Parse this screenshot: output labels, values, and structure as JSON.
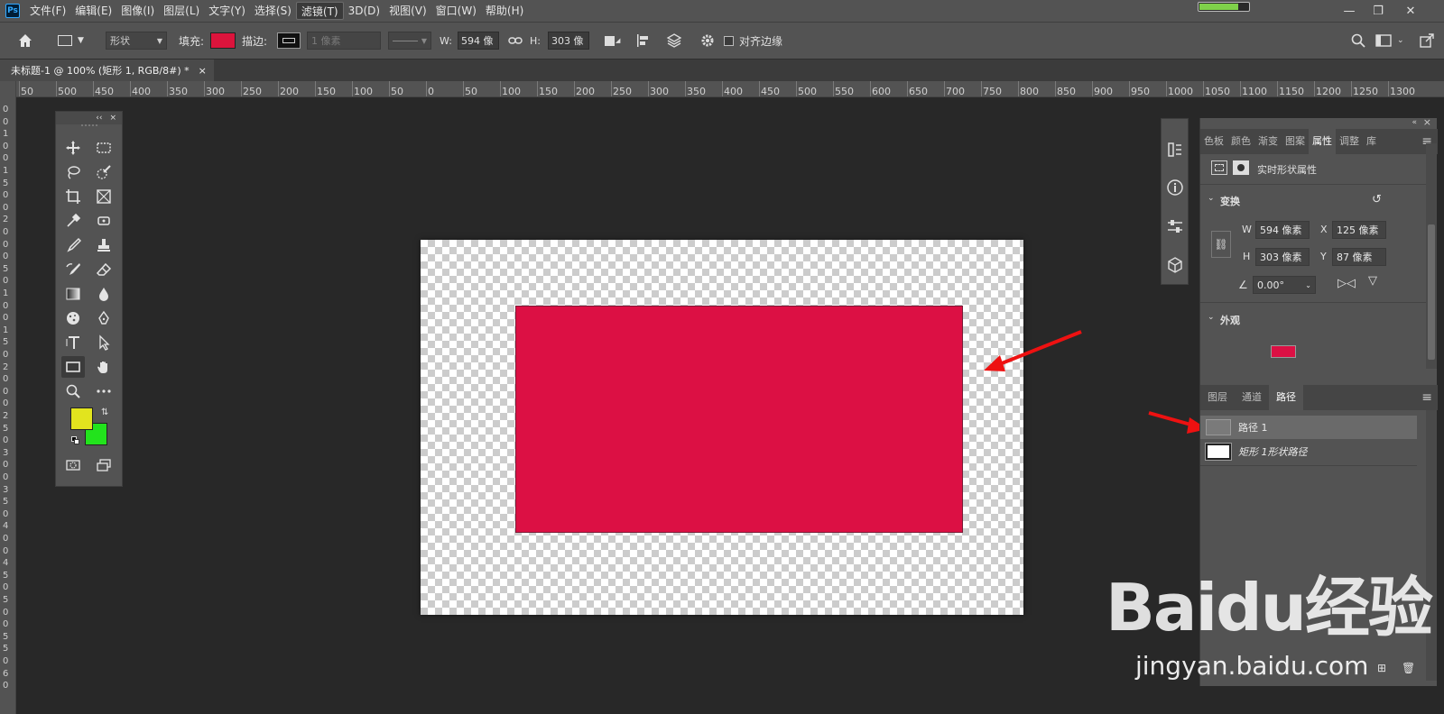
{
  "menubar": {
    "logo": "Ps",
    "items": [
      "文件(F)",
      "编辑(E)",
      "图像(I)",
      "图层(L)",
      "文字(Y)",
      "选择(S)",
      "滤镜(T)",
      "3D(D)",
      "视图(V)",
      "窗口(W)",
      "帮助(H)"
    ],
    "active_item": "滤镜(T)",
    "battery_level": 0.8
  },
  "options": {
    "mode": "形状",
    "fill_label": "填充:",
    "fill_color": "#dc143c",
    "stroke_label": "描边:",
    "stroke_width": "1 像素",
    "w_label": "W:",
    "w_value": "594 像",
    "h_label": "H:",
    "h_value": "303 像",
    "align_edges_label": "对齐边缘"
  },
  "document": {
    "tab_title": "未标题-1 @ 100% (矩形 1, RGB/8#) *",
    "close": "×"
  },
  "ruler": {
    "h_labels": [
      "50",
      "500",
      "450",
      "400",
      "350",
      "300",
      "250",
      "200",
      "150",
      "100",
      "50",
      "0",
      "50",
      "100",
      "150",
      "200",
      "250",
      "300",
      "350",
      "400",
      "450",
      "500",
      "550",
      "600",
      "650",
      "700",
      "750",
      "800",
      "850",
      "900",
      "950",
      "1000",
      "1050",
      "1100",
      "1150",
      "1200",
      "1250",
      "1300"
    ],
    "v_labels": [
      "0",
      "0",
      "1",
      "0",
      "0",
      "1",
      "5",
      "0",
      "0",
      "2",
      "0",
      "0",
      "0",
      "5",
      "0",
      "1",
      "0",
      "0",
      "1",
      "5",
      "0",
      "2",
      "0",
      "0",
      "0",
      "2",
      "5",
      "0",
      "3",
      "0",
      "0",
      "3",
      "5",
      "0",
      "4",
      "0",
      "0",
      "4",
      "5",
      "0",
      "5",
      "0",
      "0",
      "5",
      "5",
      "0",
      "6",
      "0"
    ]
  },
  "toolbox": {
    "collapse": "‹‹",
    "close": "×",
    "foreground_color": "#e2e41e",
    "background_color": "#22e31c"
  },
  "canvas": {
    "shape_color": "#dc1044"
  },
  "properties": {
    "tabs": [
      "色板",
      "颜色",
      "渐变",
      "图案",
      "属性",
      "调整",
      "库"
    ],
    "active_tab": "属性",
    "header": "实时形状属性",
    "transform_title": "变换",
    "w_label": "W",
    "w_value": "594 像素",
    "x_label": "X",
    "x_value": "125 像素",
    "h_label": "H",
    "h_value": "303 像素",
    "y_label": "Y",
    "y_value": "87 像素",
    "angle_value": "0.00°",
    "appearance_title": "外观",
    "appearance_color": "#dc1044"
  },
  "paths_panel": {
    "tabs": [
      "图层",
      "通道",
      "路径"
    ],
    "active_tab": "路径",
    "items": [
      {
        "name": "路径 1",
        "selected": true
      },
      {
        "name": "矩形 1形状路径",
        "selected": false
      }
    ]
  },
  "arrow_color": "#ee1111",
  "watermark": {
    "brand": "Baidu经验",
    "url": "jingyan.baidu.com"
  }
}
